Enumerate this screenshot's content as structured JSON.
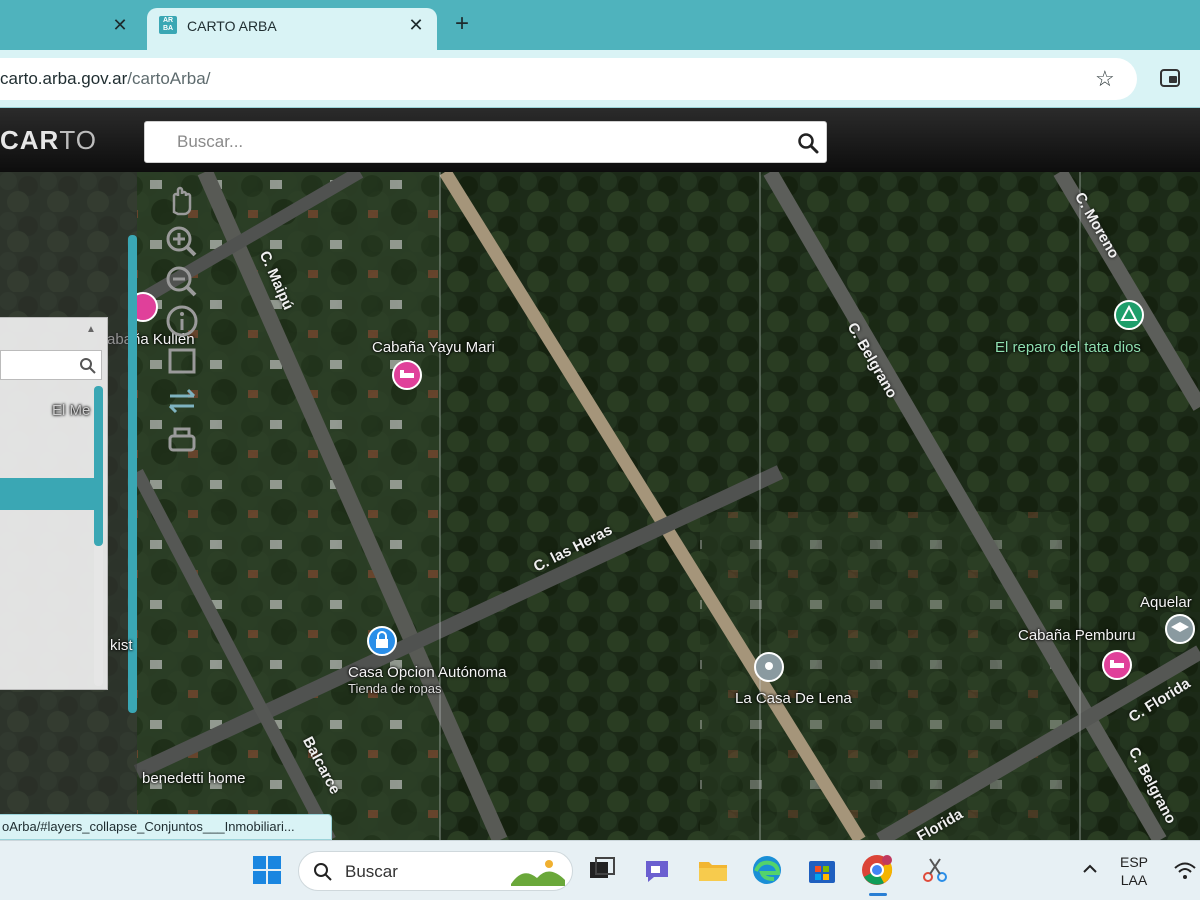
{
  "browser": {
    "tab_active_title": "CARTO ARBA",
    "favicon_text": "AR BA",
    "tab_close": "✕",
    "new_tab": "+",
    "url_host": "carto.arba.gov.ar",
    "url_path": "/cartoArba/",
    "bookmark_icon": "star-icon"
  },
  "app": {
    "logo_bold": "CAR",
    "logo_thin": "TO",
    "search_placeholder": "Buscar..."
  },
  "map": {
    "streets": [
      "C. Maipú",
      "C. Belgrano",
      "C. Moreno",
      "C. las Heras",
      "Balcarce",
      "C. Florida",
      "C. Belgrano",
      "Florida"
    ],
    "places": {
      "p1": "Cabaña Yayu Mari",
      "p2": "El reparo del tata dios",
      "p3": "Casa Opcion Autónoma",
      "p3_sub": "Tienda de ropas",
      "p4": "La Casa De Lena",
      "p5": "Cabaña Pemburu",
      "p6": "Aquelar",
      "p7": "benedetti home",
      "p8": "abaña Kullén",
      "p9": "El Me",
      "p10": "kist"
    },
    "colors": {
      "pin_lodging": "#e0409a",
      "pin_shop": "#2a8ee8",
      "pin_park": "#1e9e6a",
      "pin_generic": "#8a9aa0"
    }
  },
  "statusbar": {
    "link_text": "oArba/#layers_collapse_Conjuntos___Inmobiliari..."
  },
  "taskbar": {
    "search_label": "Buscar",
    "lang_top": "ESP",
    "lang_bottom": "LAA"
  }
}
